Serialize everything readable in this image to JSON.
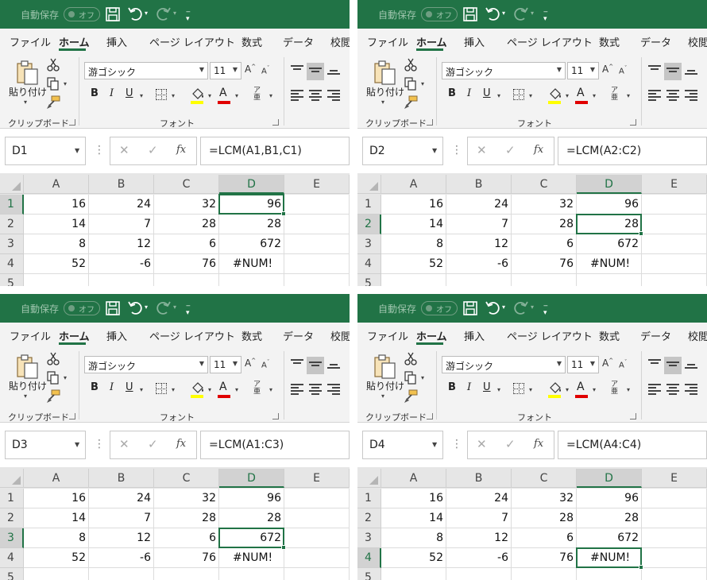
{
  "app": {
    "autosave_label": "自動保存",
    "autosave_state": "オフ"
  },
  "ribbon": {
    "tabs": [
      "ファイル",
      "ホーム",
      "挿入",
      "ページ レイアウト",
      "数式",
      "データ",
      "校閲"
    ],
    "active_tab": "ホーム",
    "clipboard": {
      "paste_label": "貼り付け",
      "group_label": "クリップボード"
    },
    "font": {
      "font_name": "游ゴシック",
      "font_size": "11",
      "group_label": "フォント",
      "fill_color": "#ffff00",
      "font_color": "#e00000"
    }
  },
  "grid": {
    "columns": [
      "A",
      "B",
      "C",
      "D",
      "E"
    ],
    "rows": [
      [
        "16",
        "24",
        "32",
        "96",
        ""
      ],
      [
        "14",
        "7",
        "28",
        "28",
        ""
      ],
      [
        "8",
        "12",
        "6",
        "672",
        ""
      ],
      [
        "52",
        "-6",
        "76",
        "#NUM!",
        ""
      ],
      [
        "",
        "",
        "",
        "",
        ""
      ]
    ],
    "row_numbers": [
      "1",
      "2",
      "3",
      "4",
      "5"
    ]
  },
  "panels": [
    {
      "namebox": "D1",
      "formula": "=LCM(A1,B1,C1)",
      "active_row": 1
    },
    {
      "namebox": "D2",
      "formula": "=LCM(A2:C2)",
      "active_row": 2
    },
    {
      "namebox": "D3",
      "formula": "=LCM(A1:C3)",
      "active_row": 3
    },
    {
      "namebox": "D4",
      "formula": "=LCM(A4:C4)",
      "active_row": 4
    }
  ],
  "colors": {
    "excel_green": "#217346"
  },
  "icons": [
    "save-icon",
    "undo-icon",
    "redo-icon",
    "paste-icon",
    "cut-icon",
    "copy-icon",
    "format-painter-icon",
    "bold-icon",
    "italic-icon",
    "underline-icon",
    "border-icon",
    "fill-color-icon",
    "font-color-icon",
    "phonetic-icon",
    "align-top-icon",
    "align-middle-icon",
    "align-bottom-icon",
    "align-left-icon",
    "align-center-icon",
    "align-right-icon",
    "cancel-icon",
    "enter-icon",
    "insert-function-icon"
  ]
}
